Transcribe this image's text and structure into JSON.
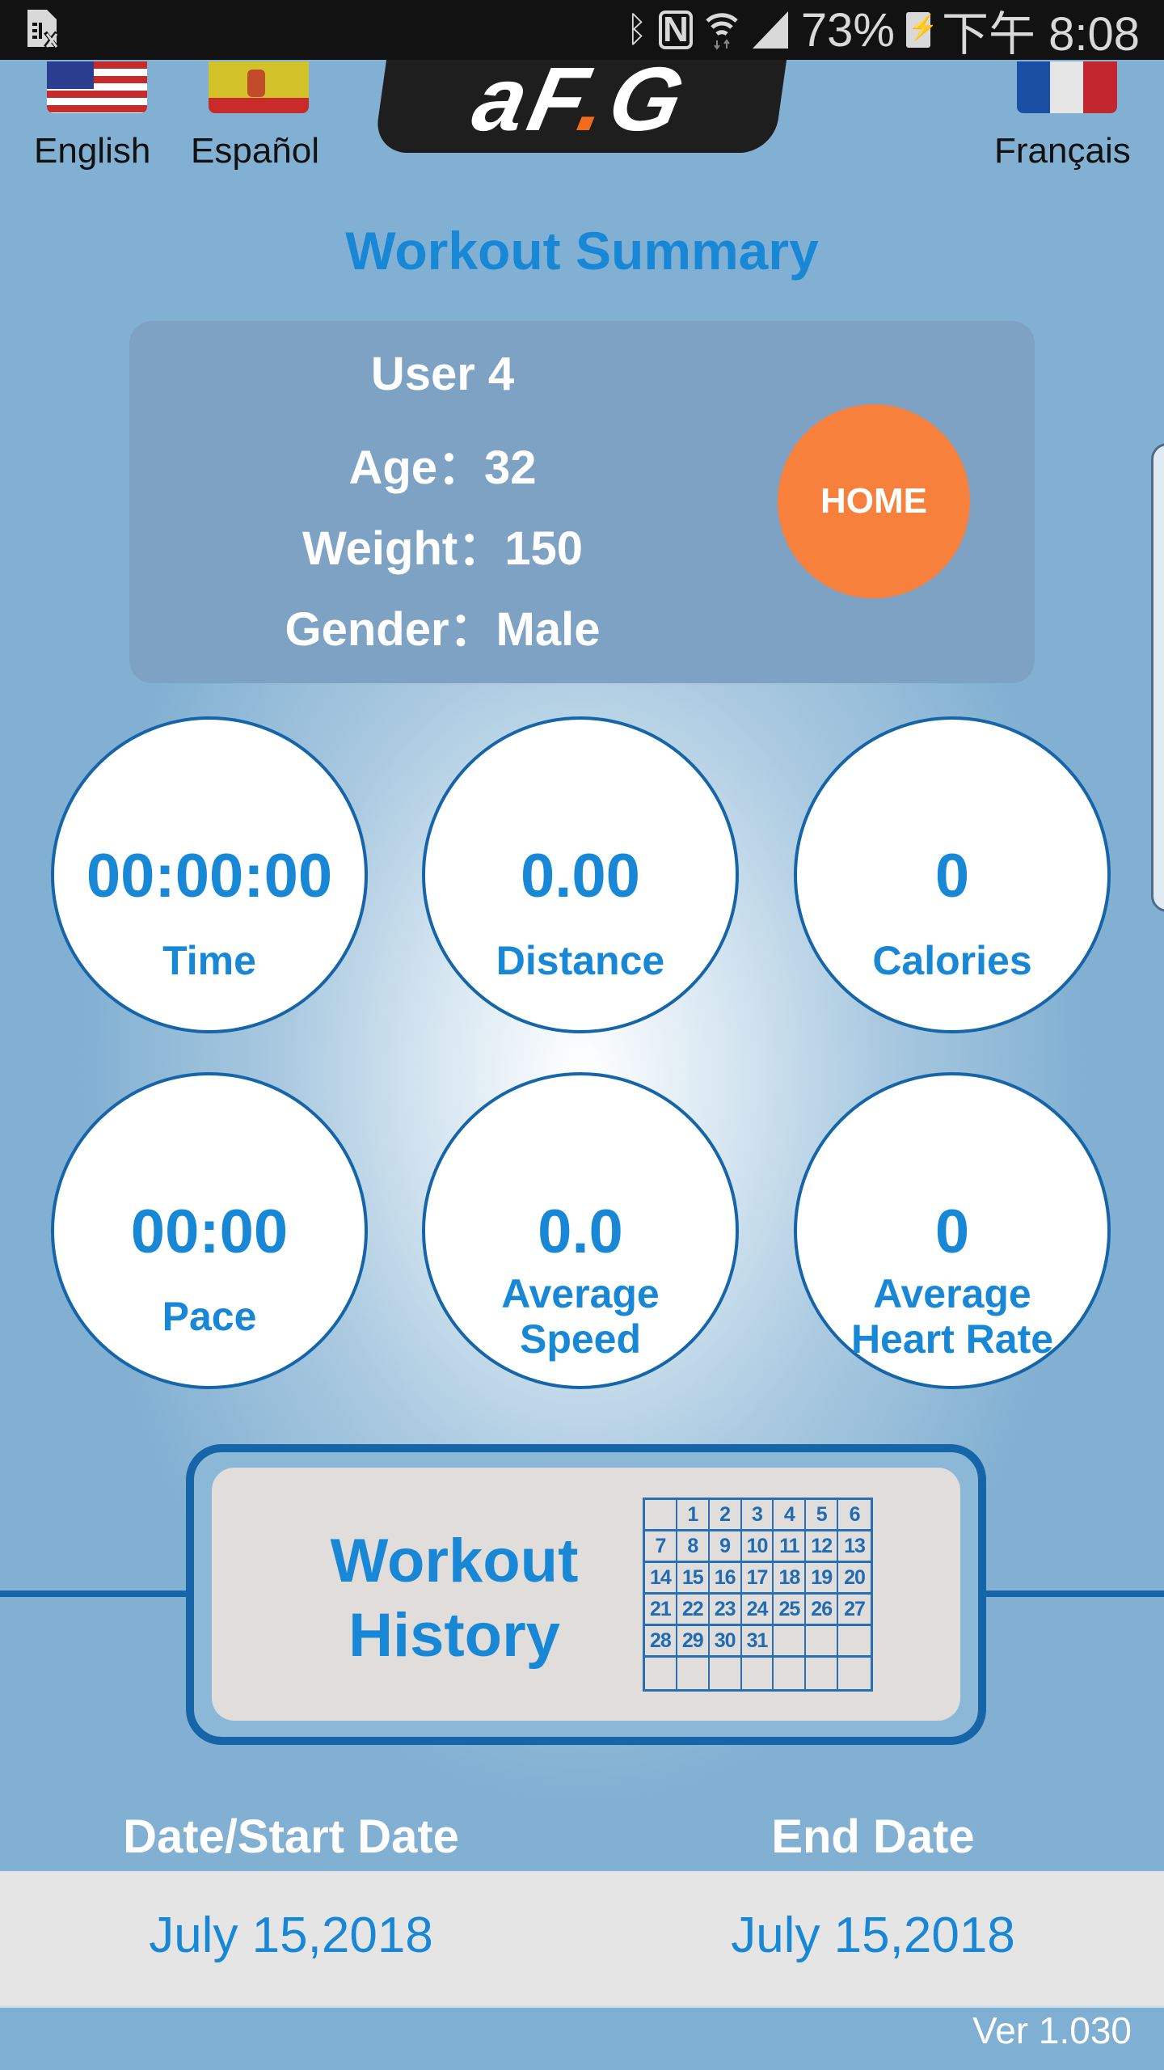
{
  "status_bar": {
    "left_icon": "sim-card-missing-icon",
    "icons": [
      "bluetooth-icon",
      "nfc-icon",
      "wifi-icon",
      "signal-icon"
    ],
    "nfc_glyph": "N",
    "battery": "73%",
    "battery_icon": "battery-charging-icon",
    "time": "下午 8:08"
  },
  "header": {
    "languages": [
      {
        "label": "English",
        "flag": "us-flag-icon"
      },
      {
        "label": "Español",
        "flag": "spain-flag-icon"
      },
      {
        "label": "Français",
        "flag": "france-flag-icon"
      }
    ],
    "logo": {
      "part1": "aF",
      "accent": ".",
      "part2": "G",
      "accent_color": "#f26a1b"
    }
  },
  "page_title": "Workout Summary",
  "user": {
    "name": "User 4",
    "age_line": "Age：32",
    "weight_line": "Weight：150",
    "gender_line": "Gender：Male",
    "home_button": "HOME"
  },
  "stats": [
    {
      "value": "00:00:00",
      "label": "Time"
    },
    {
      "value": "0.00",
      "label": "Distance"
    },
    {
      "value": "0",
      "label": "Calories"
    },
    {
      "value": "00:00",
      "label": "Pace"
    },
    {
      "value": "0.0",
      "label_line1": "Average",
      "label_line2": "Speed"
    },
    {
      "value": "0",
      "label_line1": "Average",
      "label_line2": "Heart Rate"
    }
  ],
  "history": {
    "line1": "Workout",
    "line2": "History",
    "calendar_days": [
      "",
      "1",
      "2",
      "3",
      "4",
      "5",
      "6",
      "7",
      "8",
      "9",
      "10",
      "11",
      "12",
      "13",
      "14",
      "15",
      "16",
      "17",
      "18",
      "19",
      "20",
      "21",
      "22",
      "23",
      "24",
      "25",
      "26",
      "27",
      "28",
      "29",
      "30",
      "31",
      "",
      "",
      "",
      "",
      "",
      "",
      "",
      "",
      "",
      ""
    ]
  },
  "dates": {
    "start_header": "Date/Start Date",
    "end_header": "End Date",
    "start_value": "July 15,2018",
    "end_value": "July 15,2018"
  },
  "version": "Ver 1.030",
  "colors": {
    "accent_blue": "#1787d6",
    "border_blue": "#1565a8",
    "home_orange": "#f7803c",
    "card_bg": "#7ea2c4"
  }
}
